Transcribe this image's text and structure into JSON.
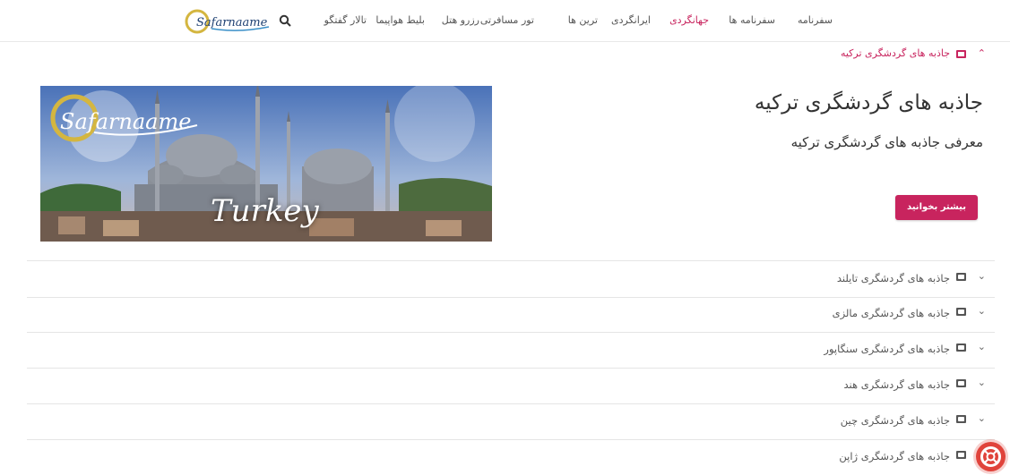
{
  "nav": {
    "items": [
      {
        "label": "سفرنامه"
      },
      {
        "label": "سفرنامه ها"
      },
      {
        "label": "جهانگردی"
      },
      {
        "label": "ایرانگردی"
      },
      {
        "label": "ترین ها"
      },
      {
        "label": "تور مسافرتی"
      },
      {
        "label": "رزرو هتل"
      },
      {
        "label": "بلیط هواپیما"
      },
      {
        "label": "تالار گفتگو"
      }
    ],
    "active_index": 2,
    "logo_text": "Safarnaame",
    "search_icon": "search-icon"
  },
  "accordion": {
    "open_item": {
      "title": "جاذبه های گردشگری ترکیه",
      "heading": "جاذبه های گردشگری ترکیه",
      "subheading": "معرفی جاذبه های گردشگری ترکیه",
      "button_label": "بیشتر بخوانید",
      "image_caption": "Turkey",
      "image_logo_text": "Safarnaame"
    },
    "items": [
      {
        "title": "جاذبه های گردشگری تایلند"
      },
      {
        "title": "جاذبه های گردشگری مالزی"
      },
      {
        "title": "جاذبه های گردشگری سنگاپور"
      },
      {
        "title": "جاذبه های گردشگری هند"
      },
      {
        "title": "جاذبه های گردشگری چین"
      },
      {
        "title": "جاذبه های گردشگری ژاپن"
      }
    ]
  },
  "colors": {
    "accent": "#c8245e",
    "help": "#e0433b"
  }
}
